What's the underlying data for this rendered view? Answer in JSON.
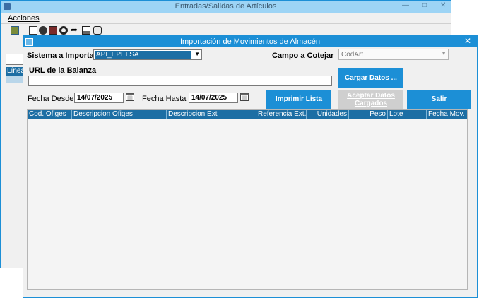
{
  "background_window": {
    "title": "Entradas/Salidas de Artículos",
    "menu": {
      "acciones": "Acciones"
    },
    "toolbar_icons": [
      "import-icon",
      "new-document-icon",
      "globe-icon",
      "print-icon",
      "binoculars-icon",
      "redirect-arrow-icon",
      "list-icon",
      "tag-icon"
    ],
    "grid_column_partial": "Línea"
  },
  "dialog": {
    "title": "Importación de Movimientos de Almacén",
    "sistema_label": "Sistema a Importar",
    "sistema_value": "API_EPELSA",
    "campo_label": "Campo a Cotejar",
    "campo_value": "CodArt",
    "url_label": "URL de la Balanza",
    "url_value": "",
    "fecha_desde_label": "Fecha Desde",
    "fecha_desde_value": "14/07/2025",
    "fecha_hasta_label": "Fecha Hasta",
    "fecha_hasta_value": "14/07/2025",
    "buttons": {
      "cargar": "Cargar Datos ...",
      "imprimir": "Imprimir Lista",
      "aceptar": "Aceptar Datos Cargados",
      "salir": "Salir"
    },
    "grid_columns": [
      "Cod. Ofiges",
      "Descripcion Ofiges",
      "Descripcion Ext",
      "Referencia Ext.",
      "Unidades",
      "Peso",
      "Lote",
      "Fecha Mov."
    ]
  },
  "colors": {
    "accent": "#1c8fd6",
    "grid_header": "#1c6ea4",
    "disabled": "#cfcfcf"
  }
}
